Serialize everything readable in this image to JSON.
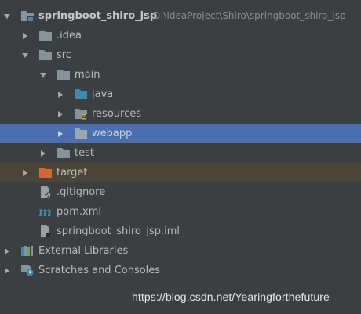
{
  "project": {
    "name": "springboot_shiro_jsp",
    "path": "D:\\IdeaProject\\Shiro\\springboot_shiro_jsp"
  },
  "tree": {
    "idea": ".idea",
    "src": "src",
    "main": "main",
    "java": "java",
    "resources": "resources",
    "webapp": "webapp",
    "test": "test",
    "target": "target",
    "gitignore": ".gitignore",
    "pom": "pom.xml",
    "iml": "springboot_shiro_jsp.iml",
    "external_libraries": "External Libraries",
    "scratches": "Scratches and Consoles"
  },
  "selected_item": "webapp",
  "icons": {
    "folder": "folder-icon",
    "source_root": "source-folder-icon",
    "resources_root": "resources-folder-icon",
    "excluded": "excluded-folder-icon",
    "git": "gitignore-file-icon",
    "maven": "maven-icon",
    "iml": "iml-file-icon",
    "libraries": "libraries-icon",
    "scratches": "scratches-icon"
  },
  "colors": {
    "background": "#3c3f41",
    "selection": "#4b6eaf",
    "excluded_row": "#4a4439",
    "folder": "#87939a",
    "source_folder": "#3d8bb3",
    "excluded_folder": "#d2692c"
  },
  "watermark": "https://blog.csdn.net/Yearingforthefuture"
}
